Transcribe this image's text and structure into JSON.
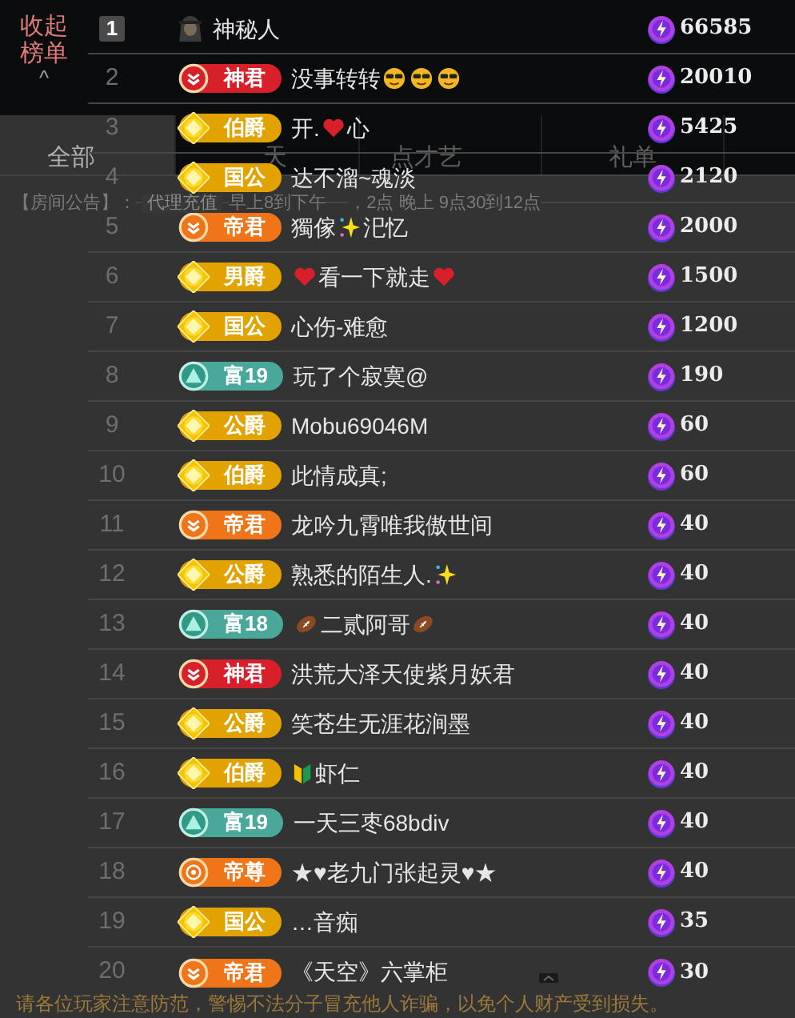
{
  "collapse_button": {
    "label": "收起榜单",
    "arrow": "^"
  },
  "tabs": [
    {
      "label": "全部",
      "selected": true
    },
    {
      "label": "天",
      "selected": false
    },
    {
      "label": "点才艺",
      "selected": false
    },
    {
      "label": "礼单",
      "selected": false
    }
  ],
  "announcement": {
    "label": "【房间公告】：",
    "button": "代理充值",
    "text_1": "早上8到下午",
    "text_2": "，2点 晚上 9点30到12点"
  },
  "notice": "请各位玩家注意防范，警惕不法分子冒充他人诈骗，以免个人财产受到损失。",
  "rows": [
    {
      "rank": "1",
      "top": true,
      "mystery": true,
      "name": [
        {
          "kind": "text",
          "text": "神秘人"
        }
      ],
      "value": "66585"
    },
    {
      "rank": "2",
      "top": false,
      "badge": {
        "label": "神君",
        "kind": "chevrons",
        "color": "#d8202a"
      },
      "name": [
        {
          "kind": "text",
          "text": "没事转转"
        },
        {
          "kind": "cool"
        },
        {
          "kind": "cool"
        },
        {
          "kind": "cool"
        }
      ],
      "value": "20010"
    },
    {
      "rank": "3",
      "top": false,
      "badge": {
        "label": "伯爵",
        "kind": "diamond",
        "color": "#e2a300"
      },
      "name": [
        {
          "kind": "text",
          "text": "开."
        },
        {
          "kind": "heart"
        },
        {
          "kind": "text",
          "text": "心"
        }
      ],
      "value": "5425"
    },
    {
      "rank": "4",
      "top": false,
      "badge": {
        "label": "国公",
        "kind": "diamond",
        "color": "#e2a300"
      },
      "name": [
        {
          "kind": "text",
          "text": "达不溜~魂淡"
        }
      ],
      "value": "2120"
    },
    {
      "rank": "5",
      "top": false,
      "badge": {
        "label": "帝君",
        "kind": "chevrons",
        "color": "#f07418"
      },
      "name": [
        {
          "kind": "text",
          "text": "獨傢"
        },
        {
          "kind": "sparkle"
        },
        {
          "kind": "text",
          "text": "汜忆"
        }
      ],
      "value": "2000"
    },
    {
      "rank": "6",
      "top": false,
      "badge": {
        "label": "男爵",
        "kind": "diamond",
        "color": "#e2a300"
      },
      "name": [
        {
          "kind": "heart"
        },
        {
          "kind": "text",
          "text": "看一下就走"
        },
        {
          "kind": "heart"
        }
      ],
      "value": "1500"
    },
    {
      "rank": "7",
      "top": false,
      "badge": {
        "label": "国公",
        "kind": "diamond",
        "color": "#e2a300"
      },
      "name": [
        {
          "kind": "text",
          "text": "心伤-难愈"
        }
      ],
      "value": "1200"
    },
    {
      "rank": "8",
      "top": false,
      "badge": {
        "label": "富19",
        "kind": "mountain",
        "color": "#4aa89a"
      },
      "name": [
        {
          "kind": "text",
          "text": "玩了个寂寞@"
        }
      ],
      "value": "190"
    },
    {
      "rank": "9",
      "top": false,
      "badge": {
        "label": "公爵",
        "kind": "diamond",
        "color": "#e2a300"
      },
      "name": [
        {
          "kind": "text",
          "text": "Mobu69046M"
        }
      ],
      "value": "60"
    },
    {
      "rank": "10",
      "top": false,
      "badge": {
        "label": "伯爵",
        "kind": "diamond",
        "color": "#e2a300"
      },
      "name": [
        {
          "kind": "text",
          "text": "此情成真;"
        }
      ],
      "value": "60"
    },
    {
      "rank": "11",
      "top": false,
      "badge": {
        "label": "帝君",
        "kind": "chevrons",
        "color": "#f07418"
      },
      "name": [
        {
          "kind": "text",
          "text": "龙吟九霄唯我傲世间"
        }
      ],
      "value": "40"
    },
    {
      "rank": "12",
      "top": false,
      "badge": {
        "label": "公爵",
        "kind": "diamond",
        "color": "#e2a300"
      },
      "name": [
        {
          "kind": "text",
          "text": "熟悉的陌生人."
        },
        {
          "kind": "sparkle"
        }
      ],
      "value": "40"
    },
    {
      "rank": "13",
      "top": false,
      "badge": {
        "label": "富18",
        "kind": "mountain",
        "color": "#4aa89a"
      },
      "name": [
        {
          "kind": "football"
        },
        {
          "kind": "text",
          "text": "二贰阿哥"
        },
        {
          "kind": "football"
        }
      ],
      "value": "40"
    },
    {
      "rank": "14",
      "top": false,
      "badge": {
        "label": "神君",
        "kind": "chevrons",
        "color": "#d8202a"
      },
      "name": [
        {
          "kind": "text",
          "text": "洪荒大泽天使紫月妖君"
        }
      ],
      "value": "40"
    },
    {
      "rank": "15",
      "top": false,
      "badge": {
        "label": "公爵",
        "kind": "diamond",
        "color": "#e2a300"
      },
      "name": [
        {
          "kind": "text",
          "text": "笑苍生无涯花涧墨"
        }
      ],
      "value": "40"
    },
    {
      "rank": "16",
      "top": false,
      "badge": {
        "label": "伯爵",
        "kind": "diamond",
        "color": "#e2a300"
      },
      "name": [
        {
          "kind": "beginner"
        },
        {
          "kind": "text",
          "text": "虾仁"
        }
      ],
      "value": "40"
    },
    {
      "rank": "17",
      "top": false,
      "badge": {
        "label": "富19",
        "kind": "mountain",
        "color": "#4aa89a"
      },
      "name": [
        {
          "kind": "text",
          "text": "一天三枣68bdiv"
        }
      ],
      "value": "40"
    },
    {
      "rank": "18",
      "top": false,
      "badge": {
        "label": "帝尊",
        "kind": "crest",
        "color": "#f07418"
      },
      "name": [
        {
          "kind": "text",
          "text": "★♥老九门张起灵♥★"
        }
      ],
      "value": "40"
    },
    {
      "rank": "19",
      "top": false,
      "badge": {
        "label": "国公",
        "kind": "diamond",
        "color": "#e2a300"
      },
      "name": [
        {
          "kind": "text",
          "text": "…音痴"
        }
      ],
      "value": "35"
    },
    {
      "rank": "20",
      "top": false,
      "badge": {
        "label": "帝君",
        "kind": "chevrons",
        "color": "#f07418"
      },
      "name": [
        {
          "kind": "text",
          "text": "《天空》六掌柜"
        }
      ],
      "value": "30"
    }
  ]
}
